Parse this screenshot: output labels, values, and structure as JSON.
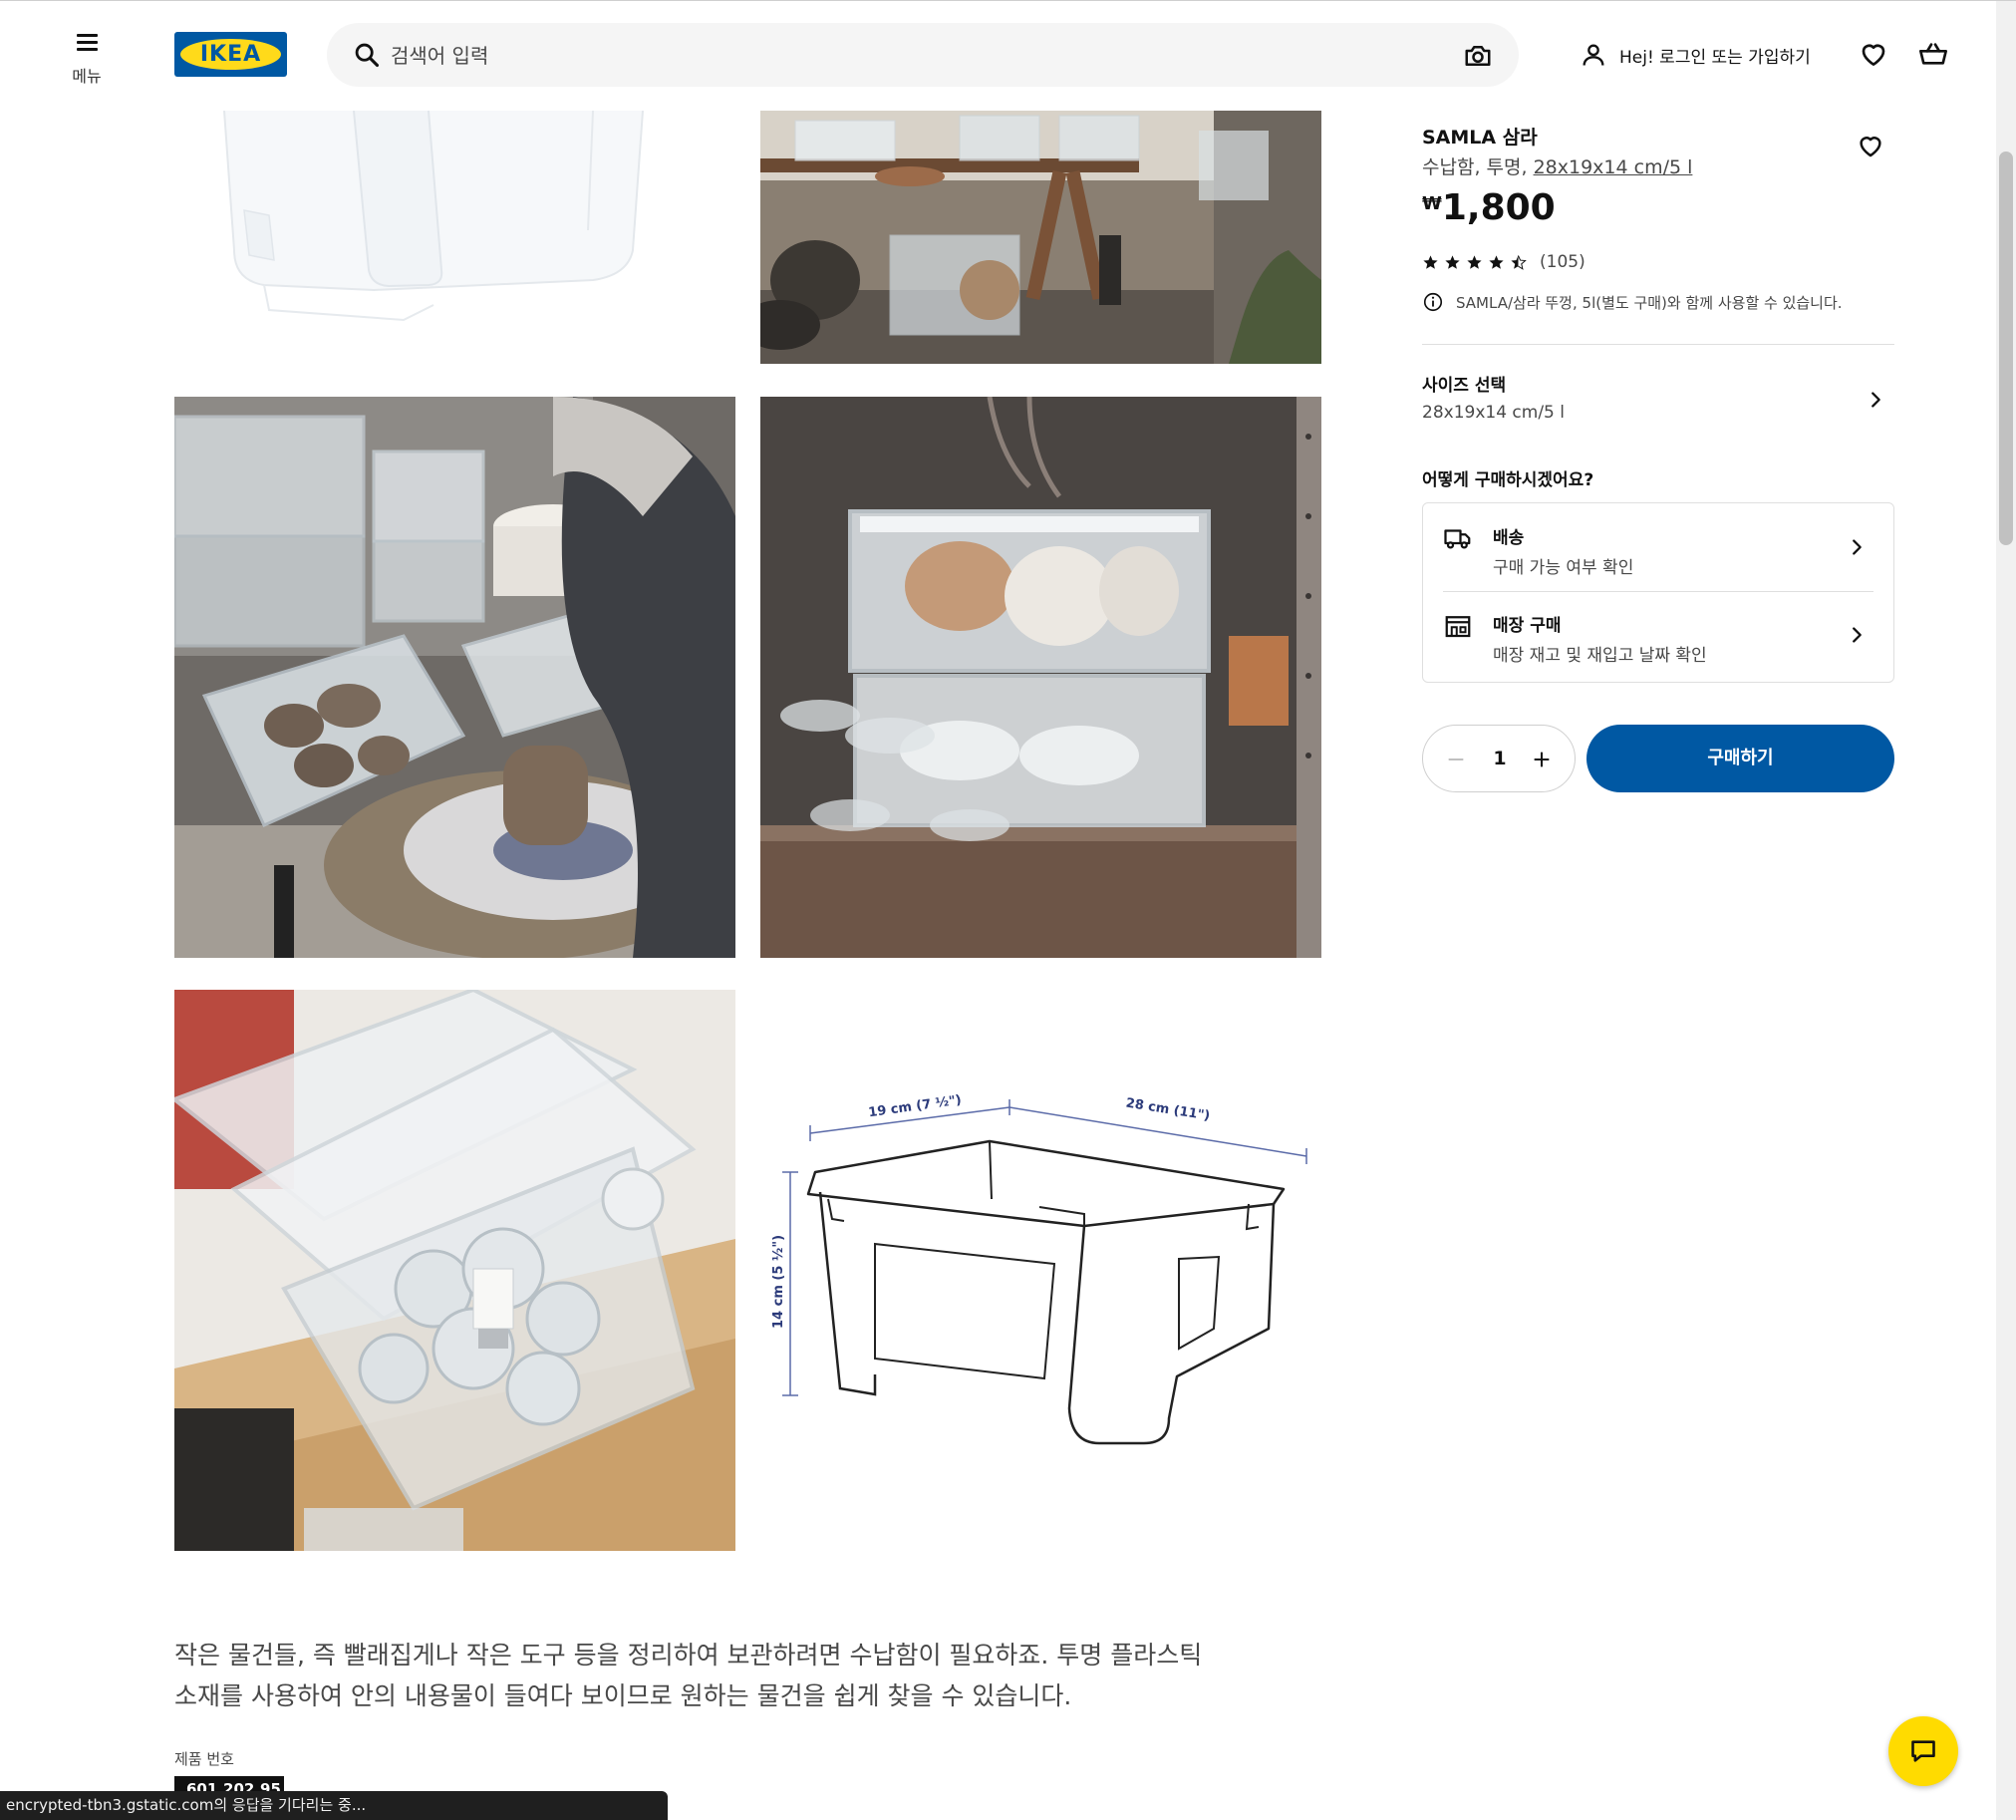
{
  "header": {
    "menu_label": "메뉴",
    "logo_text": "IKEA",
    "search_placeholder": "검색어 입력",
    "login_label": "Hej! 로그인 또는 가입하기",
    "icons": [
      "menu-icon",
      "search-icon",
      "camera-icon",
      "user-icon",
      "heart-icon",
      "cart-icon"
    ]
  },
  "gallery": {
    "images": [
      "samla-box-product-image",
      "samla-boxes-garden-shed-image",
      "samla-boxes-pottery-wheel-image",
      "samla-boxes-glassware-shelf-image",
      "samla-box-light-bulbs-image",
      "samla-box-dimension-drawing"
    ],
    "dimensions": {
      "width_label": "19 cm (7 ½\")",
      "length_label": "28 cm (11\")",
      "height_label": "14 cm (5 ½\")"
    }
  },
  "description": {
    "text": "작은 물건들, 즉 빨래집게나 작은 도구 등을 정리하여 보관하려면 수납함이 필요하죠. 투명 플라스틱 소재를 사용하여 안의 내용물이 들여다 보이므로 원하는 물건을 쉽게 찾을 수 있습니다.",
    "product_number_label": "제품 번호",
    "product_number": "601.202.95"
  },
  "product": {
    "name": "SAMLA 삼라",
    "type_prefix": "수납함, 투명, ",
    "type_link": "28x19x14 cm/5 l",
    "currency": "₩",
    "price": "1,800",
    "rating": 4.5,
    "rating_max": 5,
    "review_count": "(105)",
    "info_note": "SAMLA/삼라 뚜껑, 5l(별도 구매)와 함께 사용할 수 있습니다."
  },
  "size_selector": {
    "title": "사이즈 선택",
    "value": "28x19x14 cm/5 l"
  },
  "purchase": {
    "heading": "어떻게 구매하시겠어요?",
    "options": [
      {
        "title": "배송",
        "subtitle": "구매 가능 여부 확인",
        "icon": "truck-icon"
      },
      {
        "title": "매장 구매",
        "subtitle": "매장 재고 및 재입고 날짜 확인",
        "icon": "store-icon"
      }
    ],
    "quantity": "1",
    "buy_label": "구매하기"
  },
  "colors": {
    "ikea_blue": "#0058a3",
    "ikea_yellow": "#ffda1a",
    "chat_yellow": "#ffdb00"
  },
  "status_bar": "encrypted-tbn3.gstatic.com의 응답을 기다리는 중..."
}
